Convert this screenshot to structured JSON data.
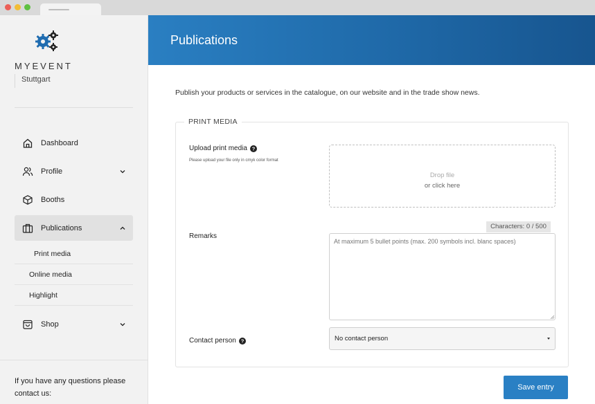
{
  "browser": {
    "tab_title": ""
  },
  "sidebar": {
    "brand": "MYEVENT",
    "city": "Stuttgart",
    "nav": [
      {
        "label": "Dashboard",
        "icon": "home-icon"
      },
      {
        "label": "Profile",
        "icon": "users-icon",
        "expandable": true
      },
      {
        "label": "Booths",
        "icon": "cube-icon"
      },
      {
        "label": "Publications",
        "icon": "briefcase-icon",
        "expandable": true,
        "expanded": true,
        "active": true
      },
      {
        "label": "Shop",
        "icon": "shopping-bag-icon",
        "expandable": true
      }
    ],
    "publications_sub": [
      {
        "label": "Print media",
        "active": true
      },
      {
        "label": "Online media"
      },
      {
        "label": "Highlight"
      }
    ],
    "help_text": "If you have any questions please contact us:"
  },
  "header": {
    "title": "Publications",
    "gradient": [
      "#2a7fc2",
      "#17558f"
    ]
  },
  "main": {
    "intro": "Publish your products or services in the catalogue, on our website and in the trade show news.",
    "section_title": "PRINT MEDIA",
    "upload": {
      "label": "Upload print media",
      "hint": "Please upload your file only in cmyk color format",
      "drop_line1": "Drop file",
      "drop_line2": "or click here"
    },
    "remarks": {
      "label": "Remarks",
      "char_count": "Characters: 0 / 500",
      "placeholder": "At maximum 5 bullet points (max. 200 symbols incl. blanc spaces)"
    },
    "contact": {
      "label": "Contact person",
      "selected": "No contact person"
    },
    "save_label": "Save entry"
  },
  "colors": {
    "accent": "#2a80c4",
    "sidebar_bg": "#f2f2f2"
  }
}
